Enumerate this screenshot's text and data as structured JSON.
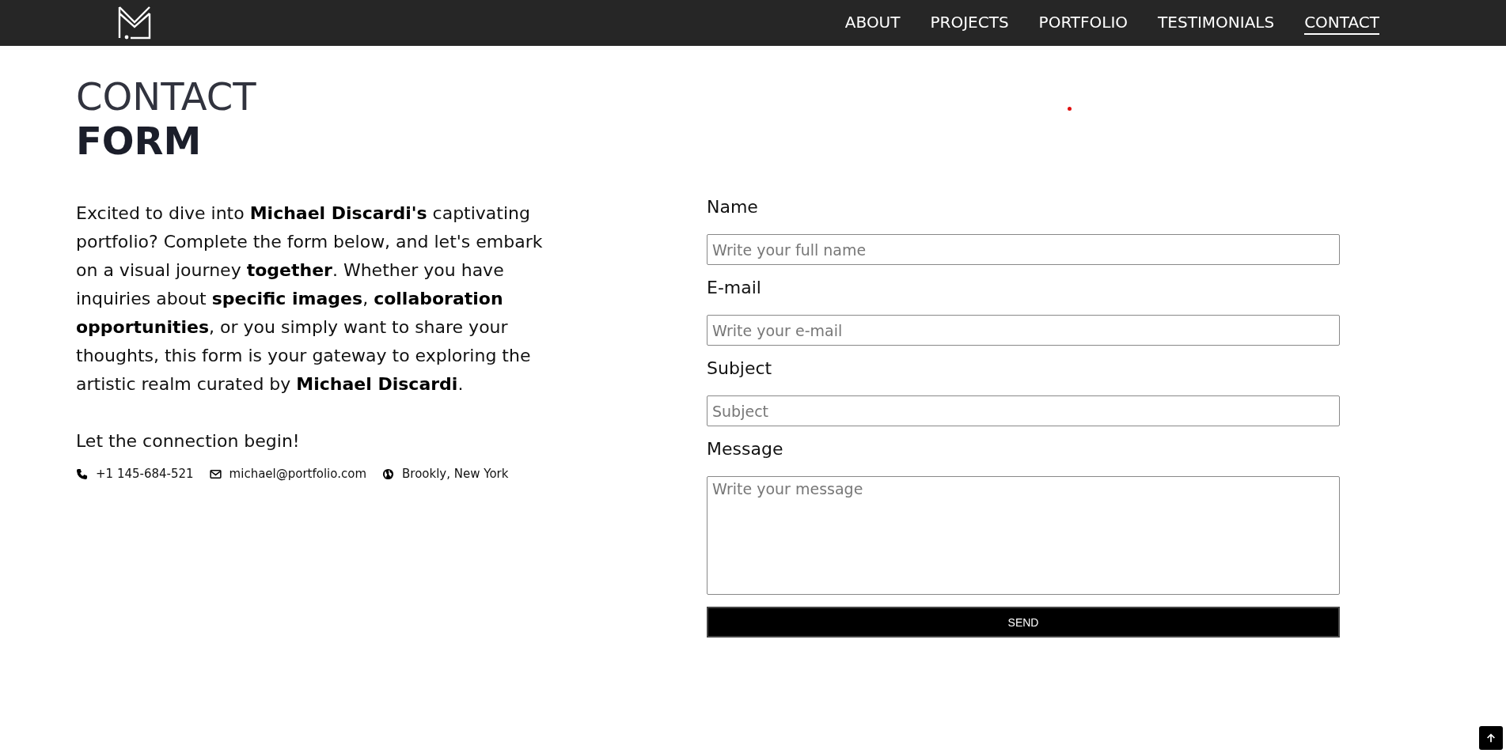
{
  "nav": {
    "items": [
      {
        "label": "ABOUT",
        "selected": false
      },
      {
        "label": "PROJECTS",
        "selected": false
      },
      {
        "label": "PORTFOLIO",
        "selected": false
      },
      {
        "label": "TESTIMONIALS",
        "selected": false
      },
      {
        "label": "CONTACT",
        "selected": true
      }
    ]
  },
  "heading": {
    "light": "CONTACT",
    "bold": "FORM"
  },
  "intro": "Excited to dive into **Michael Discardi's** captivating portfolio? Complete the form below, and let's embark on a visual journey **together**. Whether you have inquiries about **specific images**, **collaboration opportunities**, or you simply want to share your thoughts, this form is your gateway to exploring the artistic realm curated by **Michael Discardi**.",
  "closing": "Let the connection begin!",
  "contacts": [
    {
      "kind": "phone",
      "text": "+1 145-684-521"
    },
    {
      "kind": "email",
      "text": "michael@portfolio.com"
    },
    {
      "kind": "location",
      "text": "Brookly, New York"
    }
  ],
  "form": {
    "fields": [
      {
        "kind": "text",
        "label": "Name",
        "placeholder": "Write your full name"
      },
      {
        "kind": "text",
        "label": "E-mail",
        "placeholder": "Write your e-mail"
      },
      {
        "kind": "text",
        "label": "Subject",
        "placeholder": "Subject"
      },
      {
        "kind": "textarea",
        "label": "Message",
        "placeholder": "Write your message"
      }
    ],
    "submit": "SEND"
  }
}
